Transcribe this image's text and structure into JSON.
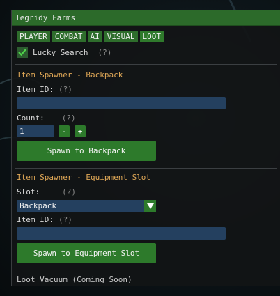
{
  "window": {
    "title": "Tegridy Farms"
  },
  "tabs": [
    {
      "label": "PLAYER"
    },
    {
      "label": "COMBAT"
    },
    {
      "label": "AI"
    },
    {
      "label": "VISUAL"
    },
    {
      "label": "LOOT",
      "active": true
    }
  ],
  "lucky_search": {
    "label": "Lucky Search",
    "hint": "(?)",
    "checked": true
  },
  "backpack_spawner": {
    "header": "Item Spawner - Backpack",
    "item_id_label": "Item ID:",
    "item_id_hint": "(?)",
    "item_id_value": "",
    "count_label": "Count:",
    "count_hint": "(?)",
    "count_value": "1",
    "minus_label": "-",
    "plus_label": "+",
    "spawn_button": "Spawn to Backpack"
  },
  "equipment_spawner": {
    "header": "Item Spawner - Equipment Slot",
    "slot_label": "Slot:",
    "slot_hint": "(?)",
    "slot_value": "Backpack",
    "item_id_label": "Item ID:",
    "item_id_hint": "(?)",
    "item_id_value": "",
    "spawn_button": "Spawn to Equipment Slot"
  },
  "footer": {
    "text": "Loot Vacuum (Coming Soon)"
  },
  "colors": {
    "accent_green": "#2d7a2b",
    "header_orange": "#e0a857",
    "input_blue": "#24405f"
  }
}
